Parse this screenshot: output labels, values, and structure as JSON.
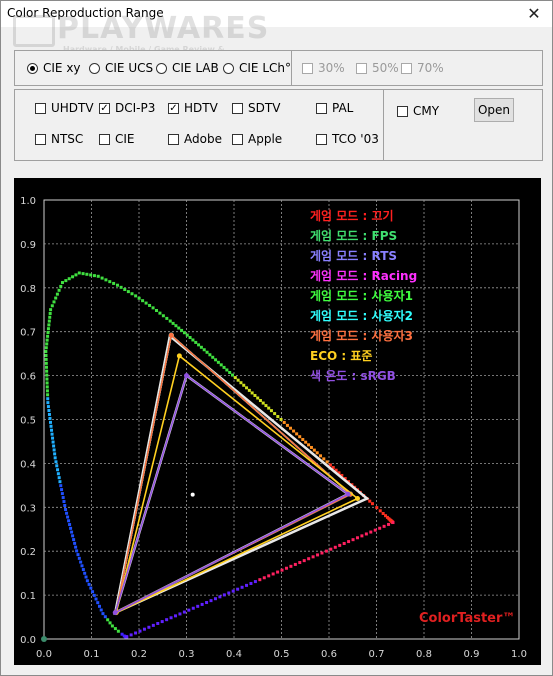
{
  "window": {
    "title": "Color Reproduction Range",
    "close_glyph": "✕"
  },
  "watermark": {
    "brand": "PLAYWARES",
    "tagline": "Hardware / Mobile / Game Review & Community"
  },
  "color_spaces": [
    {
      "label": "CIE xy",
      "selected": true
    },
    {
      "label": "CIE UCS",
      "selected": false
    },
    {
      "label": "CIE LAB",
      "selected": false
    },
    {
      "label": "CIE LCh°",
      "selected": false
    }
  ],
  "ranges": [
    {
      "label": "30%",
      "checked": false,
      "enabled": false
    },
    {
      "label": "50%",
      "checked": false,
      "enabled": false
    },
    {
      "label": "70%",
      "checked": false,
      "enabled": false
    }
  ],
  "standards_row1": [
    {
      "label": "UHDTV",
      "checked": false
    },
    {
      "label": "DCI-P3",
      "checked": true
    },
    {
      "label": "HDTV",
      "checked": true
    },
    {
      "label": "SDTV",
      "checked": false
    },
    {
      "label": "PAL",
      "checked": false
    }
  ],
  "standards_row2": [
    {
      "label": "NTSC",
      "checked": false
    },
    {
      "label": "CIE",
      "checked": false
    },
    {
      "label": "Adobe",
      "checked": false
    },
    {
      "label": "Apple",
      "checked": false
    },
    {
      "label": "TCO '03",
      "checked": false
    }
  ],
  "cmy": {
    "label": "CMY",
    "checked": false
  },
  "open_button": {
    "label": "Open"
  },
  "chart_data": {
    "type": "scatter",
    "xlim": [
      0.0,
      1.0
    ],
    "ylim": [
      0.0,
      1.0
    ],
    "x_ticks": [
      "0.0",
      "0.1",
      "0.2",
      "0.3",
      "0.4",
      "0.5",
      "0.6",
      "0.7",
      "0.8",
      "0.9",
      "1.0"
    ],
    "y_ticks": [
      "0.0",
      "0.1",
      "0.2",
      "0.3",
      "0.4",
      "0.5",
      "0.6",
      "0.7",
      "0.8",
      "0.9",
      "1.0"
    ],
    "grid": true,
    "legend_position": "top-right",
    "brand": "ColorTaster™",
    "white_point": {
      "x": 0.313,
      "y": 0.329
    },
    "series": [
      {
        "name": "게임 모드 : 끄기",
        "color": "#ff2020",
        "points": [
          [
            0.645,
            0.33
          ],
          [
            0.268,
            0.692
          ],
          [
            0.152,
            0.062
          ]
        ]
      },
      {
        "name": "게임 모드 : FPS",
        "color": "#40e070",
        "points": [
          [
            0.645,
            0.33
          ],
          [
            0.268,
            0.692
          ],
          [
            0.152,
            0.062
          ]
        ]
      },
      {
        "name": "게임 모드 : RTS",
        "color": "#8a80ff",
        "points": [
          [
            0.645,
            0.33
          ],
          [
            0.268,
            0.692
          ],
          [
            0.152,
            0.062
          ]
        ]
      },
      {
        "name": "게임 모드 : Racing",
        "color": "#ff30ff",
        "points": [
          [
            0.645,
            0.33
          ],
          [
            0.268,
            0.692
          ],
          [
            0.152,
            0.062
          ]
        ]
      },
      {
        "name": "게임 모드 : 사용자1",
        "color": "#40ff40",
        "points": [
          [
            0.645,
            0.33
          ],
          [
            0.268,
            0.692
          ],
          [
            0.152,
            0.062
          ]
        ]
      },
      {
        "name": "게임 모드 : 사용자2",
        "color": "#30ffff",
        "points": [
          [
            0.645,
            0.33
          ],
          [
            0.268,
            0.692
          ],
          [
            0.152,
            0.062
          ]
        ]
      },
      {
        "name": "게임 모드 : 사용자3",
        "color": "#ff7040",
        "points": [
          [
            0.645,
            0.33
          ],
          [
            0.268,
            0.692
          ],
          [
            0.152,
            0.062
          ]
        ]
      },
      {
        "name": "ECO : 표준",
        "color": "#ffd020",
        "points": [
          [
            0.66,
            0.32
          ],
          [
            0.285,
            0.645
          ],
          [
            0.152,
            0.06
          ]
        ]
      },
      {
        "name": "색 온도 : sRGB",
        "color": "#9050e0",
        "points": [
          [
            0.64,
            0.33
          ],
          [
            0.3,
            0.6
          ],
          [
            0.15,
            0.06
          ]
        ]
      }
    ],
    "reference_gamuts": [
      {
        "name": "DCI-P3",
        "color": "#e8e8e8",
        "points": [
          [
            0.68,
            0.32
          ],
          [
            0.265,
            0.69
          ],
          [
            0.15,
            0.06
          ]
        ]
      },
      {
        "name": "HDTV",
        "color": "#e0e0e0",
        "points": [
          [
            0.64,
            0.33
          ],
          [
            0.3,
            0.6
          ],
          [
            0.15,
            0.06
          ]
        ]
      }
    ],
    "spectral_locus": [
      [
        0.1741,
        0.005
      ],
      [
        0.1738,
        0.0049
      ],
      [
        0.1733,
        0.0048
      ],
      [
        0.1726,
        0.0048
      ],
      [
        0.1714,
        0.0051
      ],
      [
        0.1689,
        0.0069
      ],
      [
        0.1644,
        0.0109
      ],
      [
        0.1566,
        0.0177
      ],
      [
        0.144,
        0.0297
      ],
      [
        0.1241,
        0.0578
      ],
      [
        0.0913,
        0.1327
      ],
      [
        0.0687,
        0.2007
      ],
      [
        0.0454,
        0.295
      ],
      [
        0.0235,
        0.4127
      ],
      [
        0.0082,
        0.5384
      ],
      [
        0.0039,
        0.6548
      ],
      [
        0.0139,
        0.7502
      ],
      [
        0.0389,
        0.812
      ],
      [
        0.0743,
        0.8338
      ],
      [
        0.1142,
        0.8262
      ],
      [
        0.1547,
        0.8059
      ],
      [
        0.1929,
        0.7816
      ],
      [
        0.2296,
        0.7543
      ],
      [
        0.2658,
        0.7243
      ],
      [
        0.3016,
        0.6923
      ],
      [
        0.3373,
        0.6589
      ],
      [
        0.3731,
        0.6245
      ],
      [
        0.4087,
        0.5896
      ],
      [
        0.4441,
        0.5547
      ],
      [
        0.4788,
        0.5202
      ],
      [
        0.5125,
        0.4866
      ],
      [
        0.5448,
        0.4544
      ],
      [
        0.5752,
        0.4242
      ],
      [
        0.6029,
        0.3965
      ],
      [
        0.627,
        0.3725
      ],
      [
        0.6482,
        0.3514
      ],
      [
        0.6658,
        0.334
      ],
      [
        0.6801,
        0.3197
      ],
      [
        0.6915,
        0.3083
      ],
      [
        0.7006,
        0.2993
      ],
      [
        0.7079,
        0.292
      ],
      [
        0.714,
        0.2859
      ],
      [
        0.719,
        0.2809
      ],
      [
        0.723,
        0.277
      ],
      [
        0.726,
        0.274
      ],
      [
        0.7283,
        0.2717
      ],
      [
        0.73,
        0.27
      ],
      [
        0.7311,
        0.2689
      ],
      [
        0.732,
        0.268
      ],
      [
        0.7327,
        0.2673
      ],
      [
        0.7334,
        0.2666
      ],
      [
        0.734,
        0.266
      ],
      [
        0.7344,
        0.2656
      ],
      [
        0.7346,
        0.2654
      ],
      [
        0.7347,
        0.2653
      ]
    ]
  }
}
